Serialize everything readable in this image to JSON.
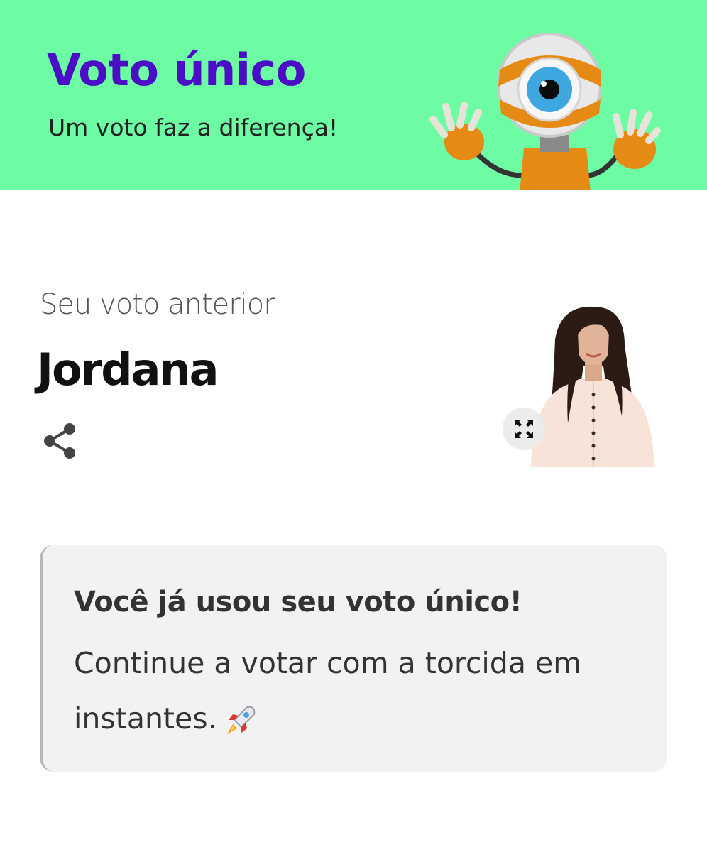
{
  "header": {
    "title": "Voto único",
    "subtitle": "Um voto faz a diferença!",
    "background_color": "#6dfca4",
    "title_color": "#4a0fc5",
    "mascot_icon": "big-brother-eye-mascot"
  },
  "previous_vote": {
    "label": "Seu voto anterior",
    "name": "Jordana",
    "share_icon": "share-icon",
    "expand_icon": "expand-icon"
  },
  "notice": {
    "title": "Você já usou seu voto único!",
    "body": "Continue a votar com a torcida em instantes.",
    "emoji_icon": "rocket-icon"
  }
}
